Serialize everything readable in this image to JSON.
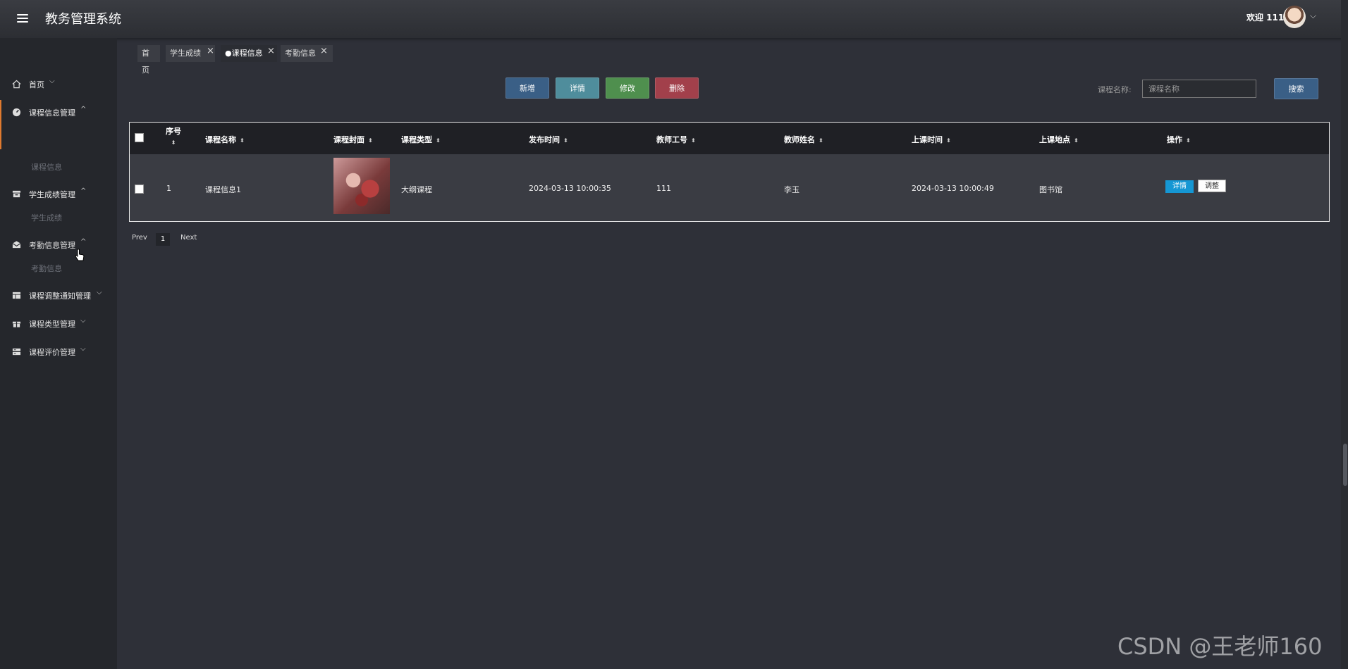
{
  "app": {
    "title": "教务管理系统"
  },
  "user": {
    "welcome": "欢迎 111"
  },
  "sidebar": {
    "items": [
      {
        "label": "首页",
        "icon": "home-icon"
      },
      {
        "label": "课程信息管理",
        "icon": "gauge-icon",
        "children": [
          "课程信息"
        ]
      },
      {
        "label": "学生成绩管理",
        "icon": "archive-icon",
        "children": [
          "学生成绩"
        ]
      },
      {
        "label": "考勤信息管理",
        "icon": "mail-icon",
        "children": [
          "考勤信息"
        ]
      },
      {
        "label": "课程调整通知管理",
        "icon": "table-icon"
      },
      {
        "label": "课程类型管理",
        "icon": "gift-icon"
      },
      {
        "label": "课程评价管理",
        "icon": "list-icon"
      }
    ]
  },
  "tabs": [
    {
      "label": "首页"
    },
    {
      "label": "学生成绩"
    },
    {
      "label": "●课程信息"
    },
    {
      "label": "考勤信息"
    }
  ],
  "toolbar": {
    "add": "新增",
    "detail": "详情",
    "edit": "修改",
    "delete": "删除"
  },
  "search": {
    "label": "课程名称:",
    "placeholder": "课程名称",
    "button": "搜索"
  },
  "table": {
    "columns": [
      "序号",
      "课程名称",
      "课程封面",
      "课程类型",
      "发布时间",
      "教师工号",
      "教师姓名",
      "上课时间",
      "上课地点",
      "操作"
    ],
    "rows": [
      {
        "index": "1",
        "course_name": "课程信息1",
        "course_type": "大纲课程",
        "publish_time": "2024-03-13 10:00:35",
        "teacher_id": "111",
        "teacher_name": "李玉",
        "class_time": "2024-03-13 10:00:49",
        "location": "图书馆",
        "actions": {
          "detail": "详情",
          "adjust": "调整"
        }
      }
    ]
  },
  "pagination": {
    "prev": "Prev",
    "page": "1",
    "next": "Next"
  },
  "watermark": "CSDN @王老师160"
}
